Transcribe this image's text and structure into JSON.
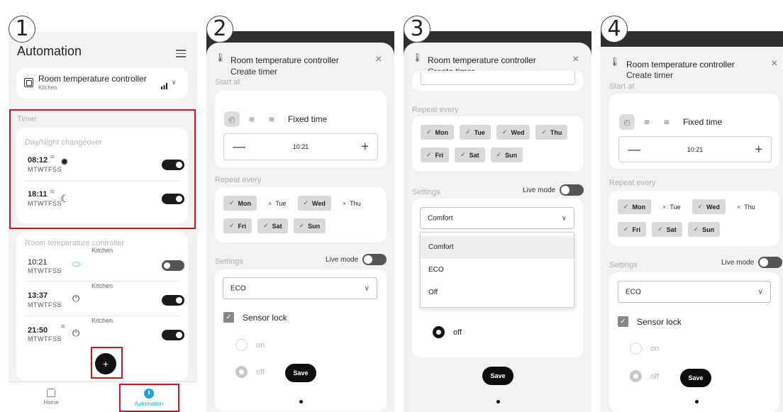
{
  "steps": [
    "1",
    "2",
    "3",
    "4"
  ],
  "screen1": {
    "title": "Automation",
    "device": {
      "name": "Room temperature controller",
      "room": "Kitchen",
      "signal_icon": "signal-bars-icon"
    },
    "timer_label": "Timer",
    "day_night": {
      "title": "Day/Night changeover",
      "rows": [
        {
          "time": "08:12",
          "days": "MTWTFSS",
          "icon": "sun-icon",
          "enabled": true
        },
        {
          "time": "18:11",
          "days": "MTWTFSS",
          "icon": "moon-icon",
          "enabled": true
        }
      ]
    },
    "controller": {
      "title": "Room temperature controller",
      "rows": [
        {
          "room": "Kitchen",
          "time": "10:21",
          "days": "MTWTFSS",
          "icon": "leaf-icon",
          "enabled": false
        },
        {
          "room": "Kitchen",
          "time": "13:37",
          "days": "MTWTFSS",
          "icon": "power-icon",
          "enabled": true
        },
        {
          "room": "Kitchen",
          "time": "21:50",
          "days": "MTWTFSS",
          "icon": "power-icon",
          "enabled": true
        }
      ]
    },
    "fab": "+",
    "nav": {
      "home": "Home",
      "automation": "Automation"
    }
  },
  "form": {
    "title": "Room temperature controller",
    "subtitle": "Create timer",
    "start_at": "Start at",
    "mode_label": "Fixed time",
    "minus": "—",
    "plus": "+",
    "time": "10:21",
    "repeat_every": "Repeat every",
    "check": "✓",
    "cross": "×",
    "days_row1": [
      "Mon",
      "Tue",
      "Wed",
      "Thu"
    ],
    "days_row2": [
      "Fri",
      "Sat",
      "Sun"
    ],
    "days_selected": {
      "Mon": true,
      "Tue": false,
      "Wed": true,
      "Thu": false,
      "Fri": true,
      "Sat": true,
      "Sun": true
    },
    "settings": "Settings",
    "live_mode": "Live mode",
    "select_value": "ECO",
    "sensor_lock": "Sensor lock",
    "on": "on",
    "off": "off",
    "save": "Save"
  },
  "screen3": {
    "repeat_every": "Repeat every",
    "days_row1": [
      "Mon",
      "Tue",
      "Wed",
      "Thu"
    ],
    "days_row2": [
      "Fri",
      "Sat",
      "Sun"
    ],
    "settings": "Settings",
    "live_mode": "Live mode",
    "select_value": "Comfort",
    "options": [
      "Comfort",
      "ECO",
      "Off"
    ],
    "partial_on": "on",
    "off": "off",
    "save": "Save"
  },
  "colors": {
    "highlight": "#d6101f",
    "accent": "#1aa3e8"
  }
}
